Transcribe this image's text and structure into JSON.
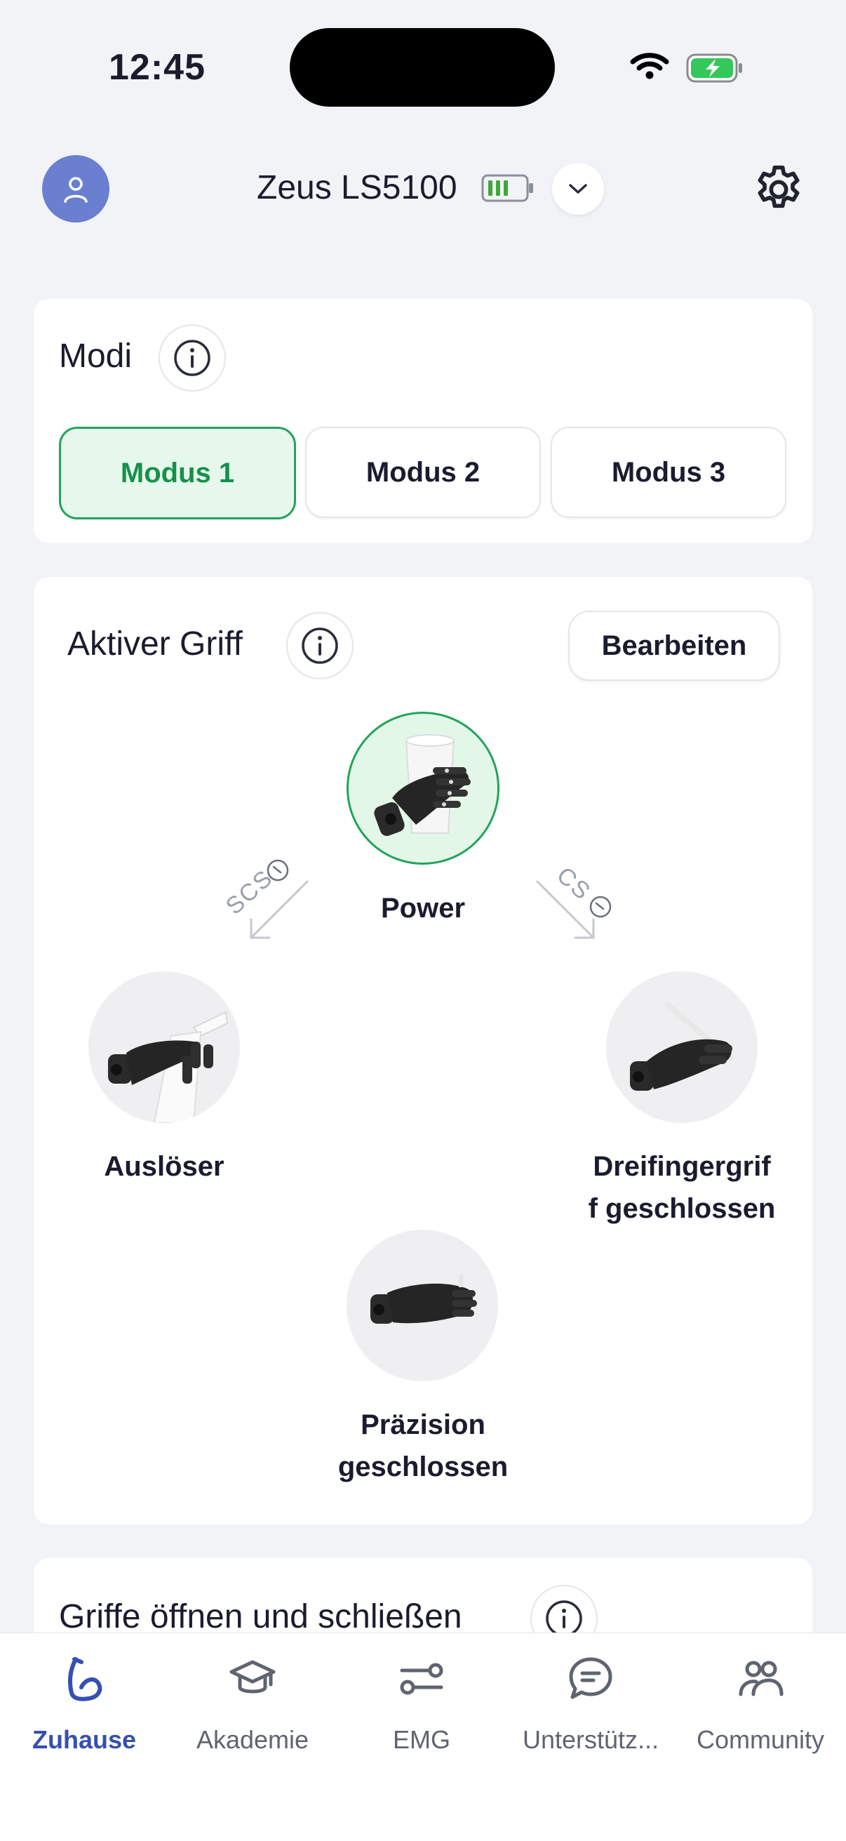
{
  "status_bar": {
    "time": "12:45"
  },
  "header": {
    "device_name": "Zeus LS5100"
  },
  "modi": {
    "title": "Modi",
    "modes": [
      {
        "label": "Modus 1",
        "active": true
      },
      {
        "label": "Modus 2",
        "active": false
      },
      {
        "label": "Modus 3",
        "active": false
      }
    ]
  },
  "active_grip": {
    "title": "Aktiver Griff",
    "edit_label": "Bearbeiten",
    "center": "Power",
    "left": "Auslöser",
    "right_line1": "Dreifingergrif",
    "right_line2": "f geschlossen",
    "bottom_line1": "Präzision",
    "bottom_line2": "geschlossen",
    "transition_left": "SCS",
    "transition_right": "CS"
  },
  "open_close": {
    "title": "Griffe öffnen und schließen"
  },
  "tabs": [
    {
      "label": "Zuhause",
      "icon": "home-arm-icon",
      "active": true
    },
    {
      "label": "Akademie",
      "icon": "graduation-cap-icon",
      "active": false
    },
    {
      "label": "EMG",
      "icon": "emg-sliders-icon",
      "active": false
    },
    {
      "label": "Unterstütz...",
      "icon": "chat-bubble-icon",
      "active": false
    },
    {
      "label": "Community",
      "icon": "people-icon",
      "active": false
    }
  ],
  "colors": {
    "accent_green": "#23a45a",
    "active_mode_bg": "#e6f8ec",
    "avatar": "#6b7fd1",
    "tab_active": "#3550b0"
  }
}
